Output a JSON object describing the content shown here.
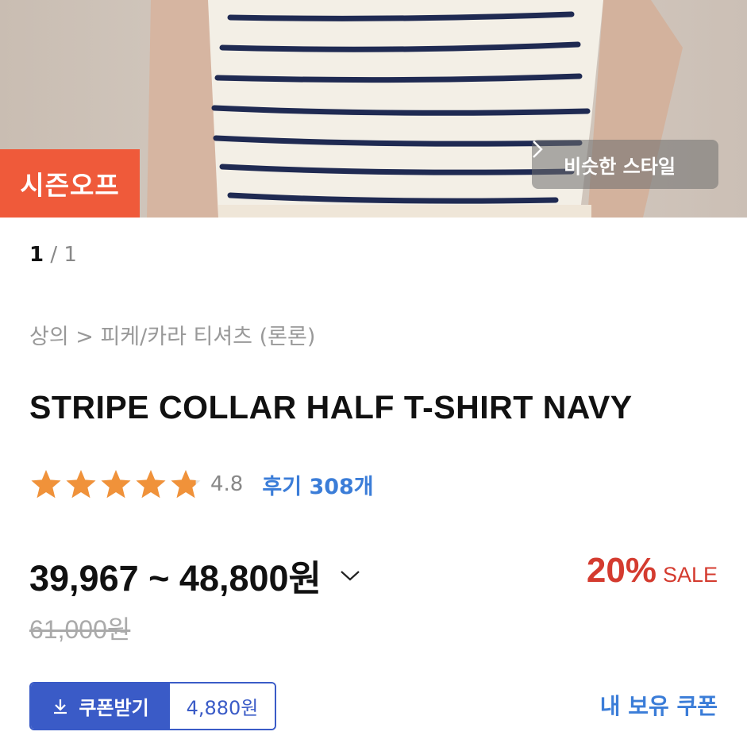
{
  "hero": {
    "badge": "시즌오프",
    "similar_style": "비슷한 스타일"
  },
  "pager": {
    "current": "1",
    "separator": " / ",
    "total": "1"
  },
  "breadcrumb": "상의 > 피케/카라 티셔츠 (론론)",
  "product": {
    "title": "STRIPE COLLAR HALF T-SHIRT NAVY",
    "rating": 4.8,
    "rating_text": "4.8",
    "review_label": "후기 308개",
    "price_range": "39,967 ~ 48,800원",
    "original_price": "61,000원",
    "discount_pct": "20%",
    "discount_label": "SALE"
  },
  "coupon": {
    "button_label": "쿠폰받기",
    "amount": "4,880원",
    "my_coupon_link": "내 보유 쿠폰"
  },
  "colors": {
    "badge": "#ef5a3a",
    "star": "#f0923a",
    "link": "#3b7dd8",
    "sale": "#d43b2f",
    "coupon": "#3a5bc7"
  }
}
